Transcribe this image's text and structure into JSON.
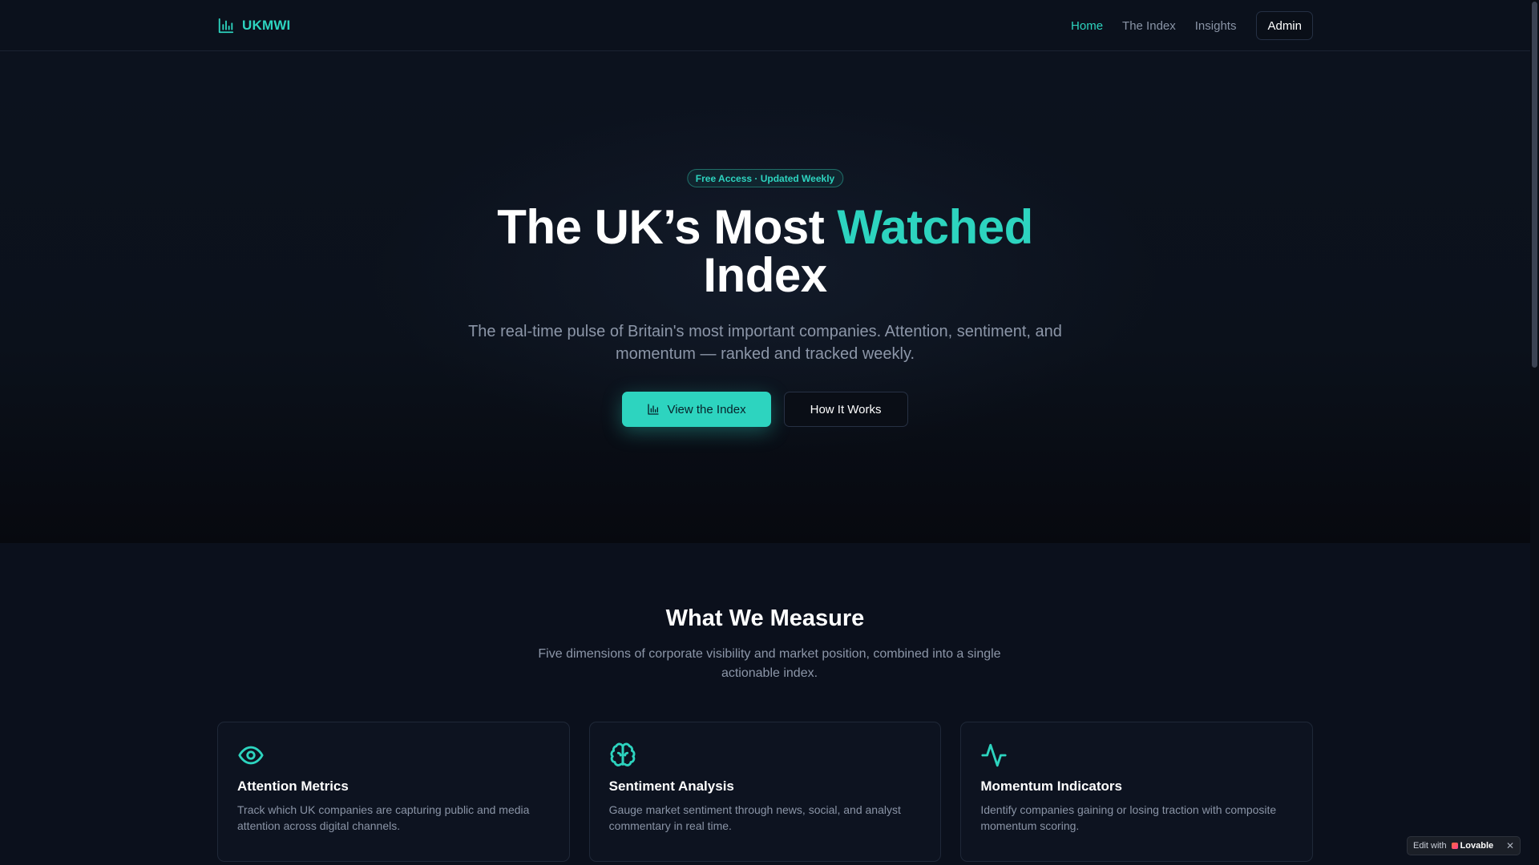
{
  "brand": {
    "name": "UKMWI"
  },
  "nav": {
    "links": [
      {
        "label": "Home",
        "active": true
      },
      {
        "label": "The Index",
        "active": false
      },
      {
        "label": "Insights",
        "active": false
      }
    ],
    "admin_label": "Admin"
  },
  "hero": {
    "badge": "Free Access · Updated Weekly",
    "title_part1": "The UK’s Most ",
    "title_accent": "Watched",
    "title_part2": "Index",
    "subtitle": "The real-time pulse of Britain's most important companies. Attention, sentiment, and momentum — ranked and tracked weekly.",
    "primary_button": "View the Index",
    "secondary_button": "How It Works"
  },
  "measure": {
    "title": "What We Measure",
    "subtitle": "Five dimensions of corporate visibility and market position, combined into a single actionable index.",
    "cards": [
      {
        "icon": "eye-icon",
        "title": "Attention Metrics",
        "desc": "Track which UK companies are capturing public and media attention across digital channels."
      },
      {
        "icon": "brain-icon",
        "title": "Sentiment Analysis",
        "desc": "Gauge market sentiment through news, social, and analyst commentary in real time."
      },
      {
        "icon": "activity-icon",
        "title": "Momentum Indicators",
        "desc": "Identify companies gaining or losing traction with composite momentum scoring."
      }
    ]
  },
  "lovable_badge": {
    "prefix": "Edit with",
    "brand": "Lovable",
    "close": "✕"
  },
  "colors": {
    "accent": "#2dd4bf",
    "background": "#0b101c"
  }
}
